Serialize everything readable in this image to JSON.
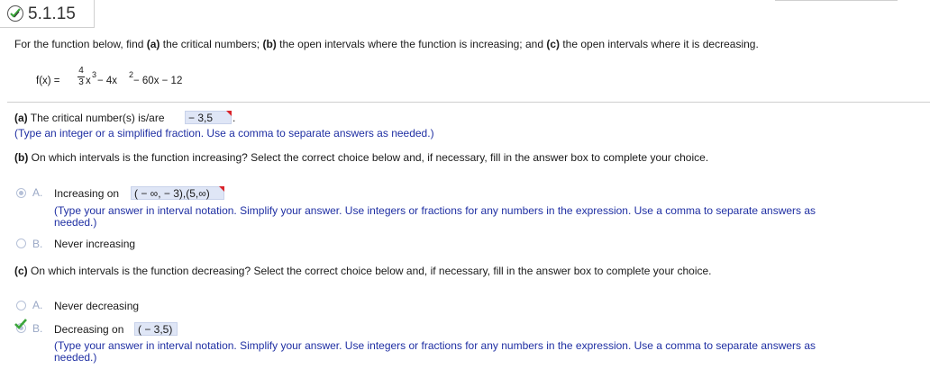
{
  "header": {
    "problem_number": "5.1.15",
    "status_icon": "check-pencil-icon"
  },
  "prompt": {
    "t1": "For the function below, find ",
    "a": "(a)",
    "t2": " the critical numbers; ",
    "b": "(b)",
    "t3": " the open intervals where the function is increasing; and ",
    "c": "(c)",
    "t4": " the open intervals where it is decreasing."
  },
  "function": {
    "lhs": "f(x) =",
    "num": "4",
    "den": "3",
    "x": "x",
    "exp3": "3",
    "mid": " − 4x",
    "exp2": "2",
    "rest": " − 60x − 12"
  },
  "part_a": {
    "label": "(a)",
    "text": " The critical number(s) is/are",
    "answer": " − 3,5",
    "period": ".",
    "hint": "(Type an integer or a simplified fraction. Use a comma to separate answers as needed.)"
  },
  "part_b": {
    "label": "(b)",
    "question": " On which intervals is the function increasing? Select the correct choice below and, if necessary, fill in the answer box to complete your choice.",
    "option_a": {
      "letter": "A.",
      "text": "Increasing on",
      "answer": "( − ∞, − 3),(5,∞)",
      "hint_line1": "(Type your answer in interval notation. Simplify your answer. Use integers or fractions for any numbers in the expression. Use a comma to separate answers as",
      "hint_line2": "needed.)"
    },
    "option_b": {
      "letter": "B.",
      "text": "Never increasing"
    }
  },
  "part_c": {
    "label": "(c)",
    "question": " On which intervals is the function decreasing? Select the correct choice below and, if necessary, fill in the answer box to complete your choice.",
    "option_a": {
      "letter": "A.",
      "text": "Never decreasing"
    },
    "option_b": {
      "letter": "B.",
      "text": "Decreasing on",
      "answer": "( − 3,5)",
      "hint_line1": "(Type your answer in interval notation. Simplify your answer. Use integers or fractions for any numbers in the expression. Use a comma to separate answers as",
      "hint_line2": "needed.)"
    }
  },
  "colors": {
    "hint_blue": "#1f2fa3",
    "answer_bg": "#dfe6f6",
    "check_green": "#3aa53a",
    "flag_red": "#d9232a"
  }
}
